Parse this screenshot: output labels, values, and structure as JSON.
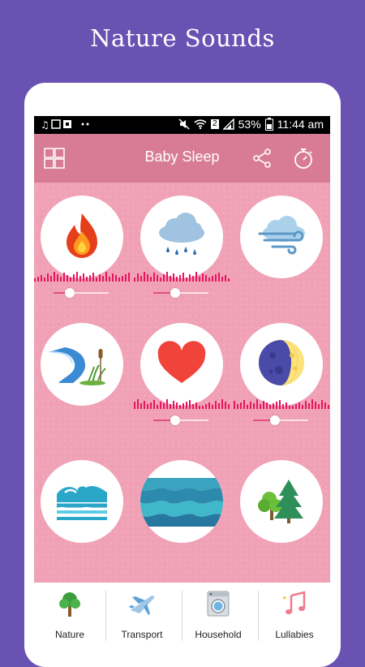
{
  "promo": {
    "title": "Nature Sounds"
  },
  "status": {
    "battery": "53%",
    "time": "11:44 am",
    "sim": "2"
  },
  "appbar": {
    "title": "Baby Sleep"
  },
  "sounds": [
    {
      "name": "fire",
      "active": true,
      "volume": 0.3
    },
    {
      "name": "rain",
      "active": true,
      "volume": 0.4
    },
    {
      "name": "wind",
      "active": false
    },
    {
      "name": "river",
      "active": false
    },
    {
      "name": "heartbeat",
      "active": true,
      "volume": 0.4
    },
    {
      "name": "moon",
      "active": true,
      "volume": 0.4
    },
    {
      "name": "waves",
      "active": false
    },
    {
      "name": "sea",
      "active": false
    },
    {
      "name": "forest",
      "active": false
    }
  ],
  "bottom_nav": [
    {
      "label": "Nature",
      "icon": "tree-icon"
    },
    {
      "label": "Transport",
      "icon": "airplane-icon"
    },
    {
      "label": "Household",
      "icon": "washing-machine-icon"
    },
    {
      "label": "Lullabies",
      "icon": "music-notes-icon"
    }
  ],
  "colors": {
    "background": "#6a52b3",
    "appbar": "#d77c94",
    "content": "#f0a1b6",
    "wave": "#e8145f"
  }
}
